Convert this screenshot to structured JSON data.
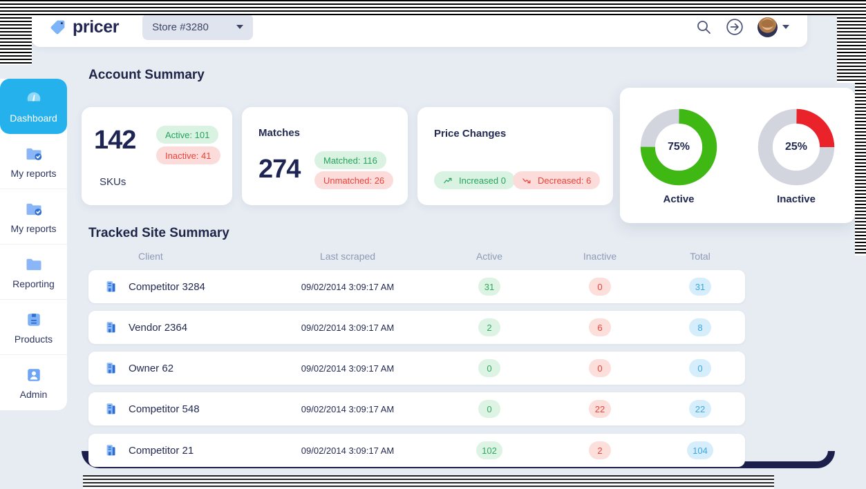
{
  "brand": {
    "name": "pricer",
    "logo_icon": "price-tag-icon"
  },
  "topbar": {
    "store_selector": {
      "value": "Store #3280",
      "caret_icon": "chevron-down-icon"
    },
    "search_icon": "search-icon",
    "login_icon": "sign-in-icon",
    "avatar": "user-avatar",
    "avatar_caret_icon": "chevron-down-icon"
  },
  "sidebar": {
    "items": [
      {
        "label": "Dashboard",
        "icon": "gauge-icon",
        "active": true
      },
      {
        "label": "My reports",
        "icon": "folder-check-icon",
        "active": false
      },
      {
        "label": "My reports",
        "icon": "folder-check-icon",
        "active": false
      },
      {
        "label": "Reporting",
        "icon": "folder-icon",
        "active": false
      },
      {
        "label": "Products",
        "icon": "box-icon",
        "active": false
      },
      {
        "label": "Admin",
        "icon": "user-square-icon",
        "active": false
      }
    ]
  },
  "account_summary": {
    "title": "Account Summary",
    "skus_card": {
      "value": "142",
      "label": "SKUs",
      "active_pill": "Active:  101",
      "inactive_pill": "Inactive:  41"
    },
    "matches_card": {
      "heading": "Matches",
      "value": "274",
      "matched_pill": "Matched:  116",
      "unmatched_pill": "Unmatched:  26"
    },
    "price_changes_card": {
      "heading": "Price Changes",
      "increased_pill": "Increased  0",
      "decreased_pill": "Decreased:  6",
      "increase_icon": "trend-up-icon",
      "decrease_icon": "trend-down-icon"
    }
  },
  "chart_data": [
    {
      "type": "pie",
      "title": "Active",
      "categories": [
        "Active",
        "Remainder"
      ],
      "values": [
        75,
        25
      ],
      "center_label": "75%",
      "colors": [
        "#3fb814",
        "#d3d5de"
      ],
      "legend": "none"
    },
    {
      "type": "pie",
      "title": "Inactive",
      "categories": [
        "Inactive",
        "Remainder"
      ],
      "values": [
        25,
        75
      ],
      "center_label": "25%",
      "colors": [
        "#ea2229",
        "#d3d5de"
      ],
      "legend": "none"
    }
  ],
  "tracked_sites": {
    "title": "Tracked Site Summary",
    "columns": [
      "Client",
      "Last scraped",
      "Active",
      "Inactive",
      "Total"
    ],
    "rows": [
      {
        "icon": "building-icon",
        "client": "Competitor 3284",
        "last_scraped": "09/02/2014 3:09:17 AM",
        "active": "31",
        "inactive": "0",
        "total": "31"
      },
      {
        "icon": "building-icon",
        "client": "Vendor 2364",
        "last_scraped": "09/02/2014 3:09:17 AM",
        "active": "2",
        "inactive": "6",
        "total": "8"
      },
      {
        "icon": "building-icon",
        "client": "Owner 62",
        "last_scraped": "09/02/2014 3:09:17 AM",
        "active": "0",
        "inactive": "0",
        "total": "0"
      },
      {
        "icon": "building-icon",
        "client": "Competitor 548",
        "last_scraped": "09/02/2014 3:09:17 AM",
        "active": "0",
        "inactive": "22",
        "total": "22"
      },
      {
        "icon": "building-icon",
        "client": "Competitor 21",
        "last_scraped": "09/02/2014 3:09:17 AM",
        "active": "102",
        "inactive": "2",
        "total": "104"
      }
    ]
  },
  "colors": {
    "page_bg": "#e7ecf3",
    "accent_blue": "#25b2ec",
    "navy": "#1e2552",
    "green": "#3fb814",
    "red": "#ea2229",
    "icon_blue": "#6ea8f5"
  }
}
